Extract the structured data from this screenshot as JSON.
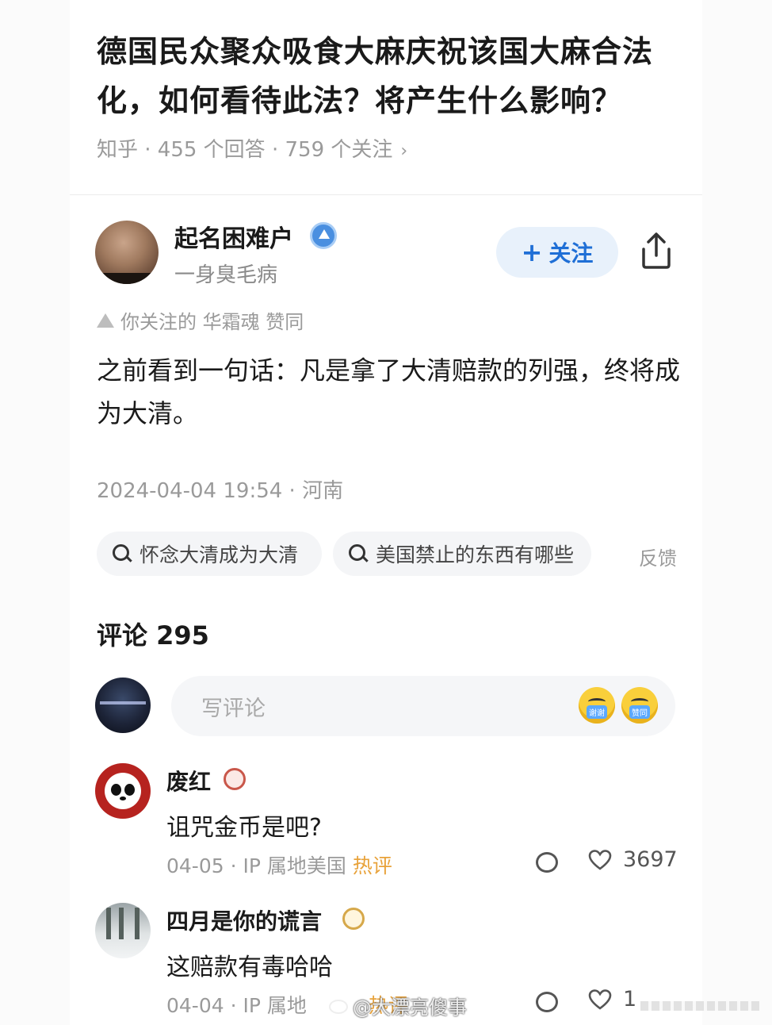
{
  "question": {
    "title": "德国民众聚众吸食大麻庆祝该国大麻合法化，如何看待此法？将产生什么影响？",
    "meta": "知乎 · 455 个回答 · 759 个关注"
  },
  "author": {
    "name": "起名困难户",
    "bio": "一身臭毛病",
    "follow_label": "关注",
    "upvoted_by": "你关注的 华霜魂 赞同"
  },
  "answer": {
    "text": "之前看到一句话：凡是拿了大清赔款的列强，终将成为大清。",
    "time_location": "2024-04-04 19:54 · 河南"
  },
  "related_searches": [
    "怀念大清成为大清",
    "美国禁止的东西有哪些"
  ],
  "feedback_label": "反馈",
  "comments_header": "评论 295",
  "comment_input": {
    "placeholder": "写评论"
  },
  "emoji_labels": [
    "谢谢",
    "赞同"
  ],
  "comments": [
    {
      "user": "废红",
      "text": "诅咒金币是吧?",
      "date_ip": "04-05 · IP 属地美国",
      "tag": "热评",
      "likes": "3697"
    },
    {
      "user": "四月是你的谎言",
      "text": "这赔款有毒哈哈",
      "date_ip": "04-04 · IP 属地",
      "tag": "热评",
      "likes": "1"
    }
  ],
  "watermark": "@大漂亮傻事"
}
